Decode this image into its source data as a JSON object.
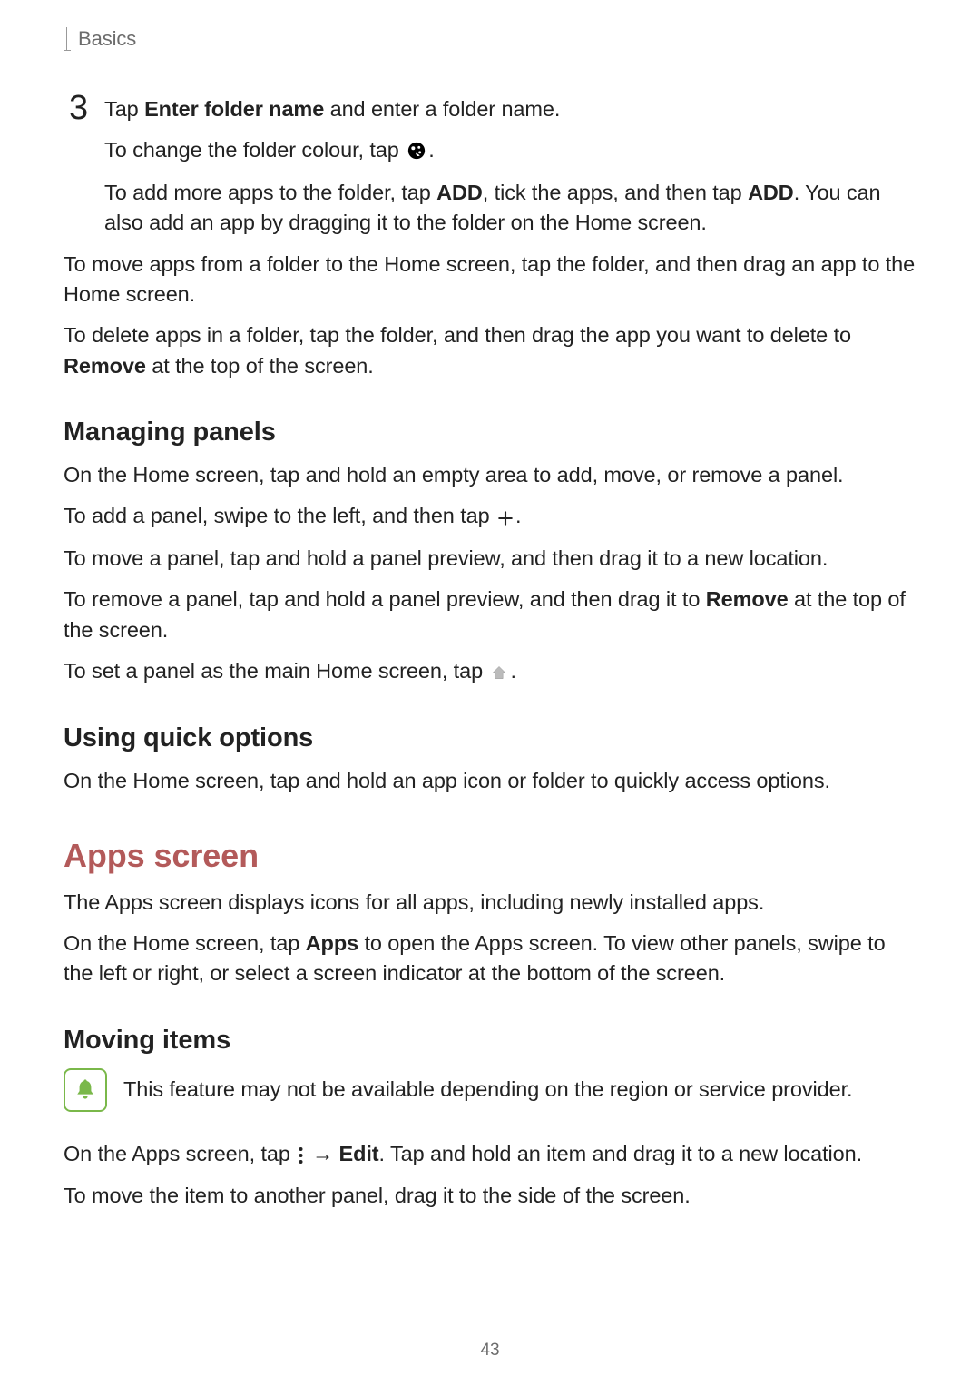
{
  "breadcrumb": "Basics",
  "step": {
    "number": "3",
    "line1_pre": "Tap ",
    "line1_bold": "Enter folder name",
    "line1_post": " and enter a folder name.",
    "line2_pre": "To change the folder colour, tap ",
    "line2_post": ".",
    "line3_pre": "To add more apps to the folder, tap ",
    "line3_b1": "ADD",
    "line3_mid": ", tick the apps, and then tap ",
    "line3_b2": "ADD",
    "line3_post": ". You can also add an app by dragging it to the folder on the Home screen."
  },
  "body": {
    "move_apps": "To move apps from a folder to the Home screen, tap the folder, and then drag an app to the Home screen.",
    "delete_pre": "To delete apps in a folder, tap the folder, and then drag the app you want to delete to ",
    "delete_bold": "Remove",
    "delete_post": " at the top of the screen."
  },
  "managing": {
    "heading": "Managing panels",
    "p1": "On the Home screen, tap and hold an empty area to add, move, or remove a panel.",
    "p2_pre": "To add a panel, swipe to the left, and then tap ",
    "p2_post": ".",
    "p3": "To move a panel, tap and hold a panel preview, and then drag it to a new location.",
    "p4_pre": "To remove a panel, tap and hold a panel preview, and then drag it to ",
    "p4_bold": "Remove",
    "p4_post": " at the top of the screen.",
    "p5_pre": "To set a panel as the main Home screen, tap ",
    "p5_post": "."
  },
  "quick": {
    "heading": "Using quick options",
    "p1": "On the Home screen, tap and hold an app icon or folder to quickly access options."
  },
  "apps_screen": {
    "heading": "Apps screen",
    "p1": "The Apps screen displays icons for all apps, including newly installed apps.",
    "p2_pre": "On the Home screen, tap ",
    "p2_bold": "Apps",
    "p2_post": " to open the Apps screen. To view other panels, swipe to the left or right, or select a screen indicator at the bottom of the screen."
  },
  "moving": {
    "heading": "Moving items",
    "notice": "This feature may not be available depending on the region or service provider.",
    "p1_pre": "On the Apps screen, tap ",
    "p1_arrow": " → ",
    "p1_bold": "Edit",
    "p1_post": ". Tap and hold an item and drag it to a new location.",
    "p2": "To move the item to another panel, drag it to the side of the screen."
  },
  "page_number": "43",
  "icons": {
    "palette": "palette-icon",
    "plus": "plus-icon",
    "home": "home-icon",
    "more": "more-icon",
    "bell": "bell-icon"
  }
}
